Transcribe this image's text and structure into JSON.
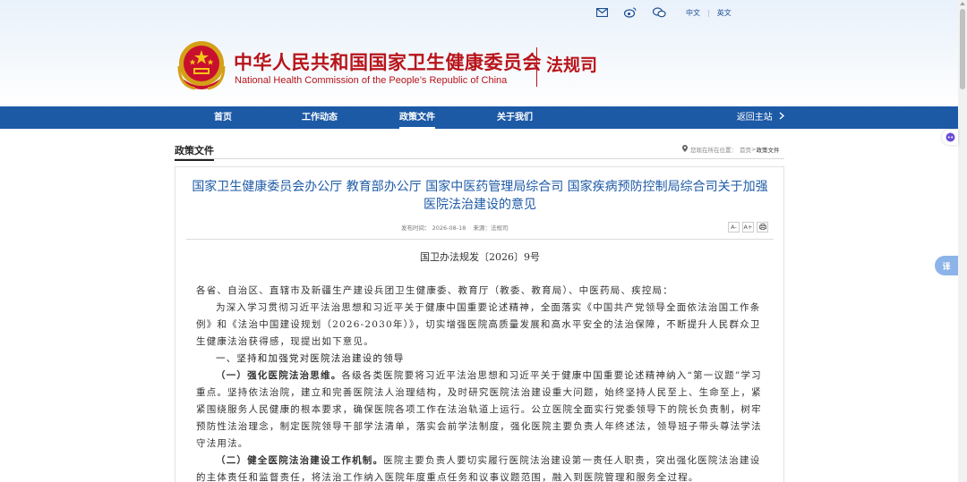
{
  "top_links": {
    "icons": [
      "mail-icon",
      "weibo-icon",
      "wechat-icon"
    ],
    "lang_cn": "中文",
    "separator": "|",
    "lang_en": "英文"
  },
  "brand": {
    "title_cn": "中华人民共和国国家卫生健康委员会",
    "title_en": "National Health Commission of the People’s Republic of China",
    "dept": "法规司",
    "primary_color": "#b8141a"
  },
  "nav": {
    "items": [
      "首页",
      "工作动态",
      "政策文件",
      "关于我们"
    ],
    "active_index": 2,
    "back_label": "返回主站",
    "bar_color": "#1d5aa6"
  },
  "section": {
    "title": "政策文件",
    "location_prefix": "您现在所在位置：",
    "breadcrumb_home": "首页",
    "breadcrumb_sep": ">",
    "breadcrumb_current": "政策文件"
  },
  "article": {
    "title": "国家卫生健康委员会办公厅 教育部办公厅 国家中医药管理局综合司 国家疾病预防控制局综合司关于加强医院法治建设的意见",
    "meta_date": "发布时间：    2026-08-18",
    "meta_source": "来源：法规司",
    "tools": [
      "A-",
      "A+",
      "print-icon"
    ],
    "doc_number": "国卫办法规发〔2026〕9号",
    "paragraphs": {
      "addressee": "各省、自治区、直辖市及新疆生产建设兵团卫生健康委、教育厅（教委、教育局）、中医药局、疾控局：",
      "intro": "为深入学习贯彻习近平法治思想和习近平关于健康中国重要论述精神，全面落实《中国共产党领导全面依法治国工作条例》和《法治中国建设规划（2026-2030年）》，切实增强医院高质量发展和高水平安全的法治保障，不断提升人民群众卫生健康法治获得感，现提出如下意见。",
      "heading1": "一、坚持和加强党对医院法治建设的领导",
      "p1_lead": "（一）强化医院法治思维。",
      "p1_body": "各级各类医院要将习近平法治思想和习近平关于健康中国重要论述精神纳入“第一议题”学习重点。坚持依法治院，建立和完善医院法人治理结构，及时研究医院法治建设重大问题，始终坚持人民至上、生命至上，紧紧围绕服务人民健康的根本要求，确保医院各项工作在法治轨道上运行。公立医院全面实行党委领导下的院长负责制，树牢预防性法治理念，制定医院领导干部学法清单，落实会前学法制度，强化医院主要负责人年终述法，领导班子带头尊法学法守法用法。",
      "p2_lead": "（二）健全医院法治建设工作机制。",
      "p2_body": "医院主要负责人要切实履行医院法治建设第一责任人职责，突出强化医院法治建设的主体责任和监督责任，将法治工作纳入医院年度重点任务和议事议题范围，融入到医院管理和服务全过程。"
    }
  },
  "widgets": {
    "translate_label": "译"
  }
}
